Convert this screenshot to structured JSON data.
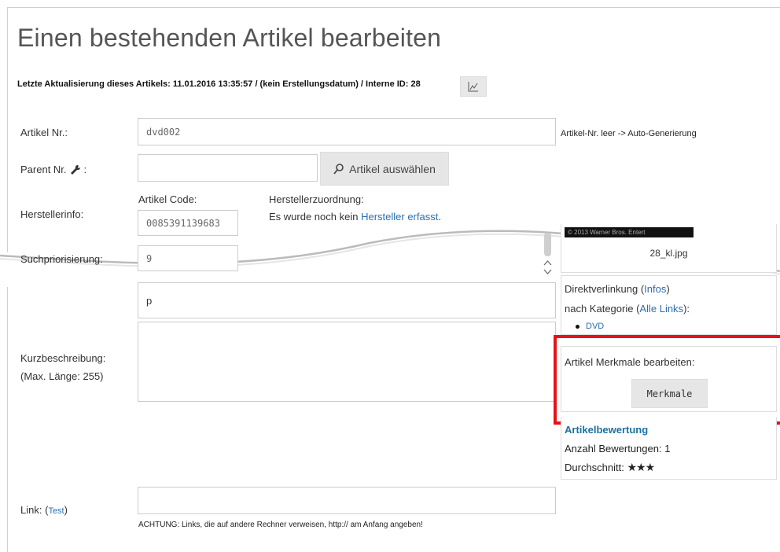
{
  "page": {
    "title": "Einen bestehenden Artikel bearbeiten",
    "meta_text": "Letzte Aktualisierung dieses Artikels: 11.01.2016 13:35:57 / (kein Erstellungsdatum) / Interne ID: 28"
  },
  "fields": {
    "artikel_nr_label": "Artikel Nr.:",
    "artikel_nr_value": "dvd002",
    "artikel_nr_hint": "Artikel-Nr. leer -> Auto-Generierung",
    "parent_nr_label": "Parent Nr.",
    "parent_nr_colon": ":",
    "parent_nr_value": "",
    "select_article_label": "Artikel auswählen",
    "herstellerinfo_label": "Herstellerinfo:",
    "artikel_code_label": "Artikel Code:",
    "artikel_code_value": "0085391139683",
    "herstellerzuordnung_label": "Herstellerzuordnung:",
    "hersteller_text_prefix": "Es wurde noch kein",
    "hersteller_link": "Hersteller erfasst",
    "hersteller_text_suffix": ".",
    "suchpriorisierung_label": "Suchpriorisierung:",
    "suchpriorisierung_value": "9",
    "textarea_top_value": "p",
    "kurzbeschreibung_label": "Kurzbeschreibung:",
    "kurzbeschreibung_sub": "(Max. Länge: 255)",
    "kurzbeschreibung_value": "",
    "link_label": "Link:",
    "link_test": "Test",
    "link_paren_open": "(",
    "link_paren_close": ")",
    "link_value": "",
    "link_warning": "ACHTUNG: Links, die auf andere Rechner verweisen, http:// am Anfang angeben!"
  },
  "sidebar": {
    "image_caption_strip": "© 2013 Warner Bros. Entert",
    "image_filename": "28_kl.jpg",
    "direktverlinkung_label": "Direktverlinkung",
    "direktverlinkung_infos": "Infos",
    "nach_kategorie_label": "nach Kategorie",
    "alle_links": "Alle Links",
    "category_item": "DVD",
    "paren_open": "(",
    "paren_close": ")",
    "paren_close_colon": "):",
    "merkmale_heading": "Artikel Merkmale bearbeiten:",
    "merkmale_button": "Merkmale",
    "bewertung_heading": "Artikelbewertung",
    "anzahl_bewertungen": "Anzahl Bewertungen: 1",
    "durchschnitt_label": "Durchschnitt:",
    "durchschnitt_stars": "★★★"
  },
  "colors": {
    "link": "#2a6fb5",
    "highlight": "#e8101a",
    "button_bg": "#e6e6e6"
  },
  "icons": {
    "chart": "chart-icon",
    "wrench": "wrench-icon",
    "search": "search-icon",
    "scroll_up": "chevron-up-icon",
    "scroll_down": "chevron-down-icon"
  }
}
